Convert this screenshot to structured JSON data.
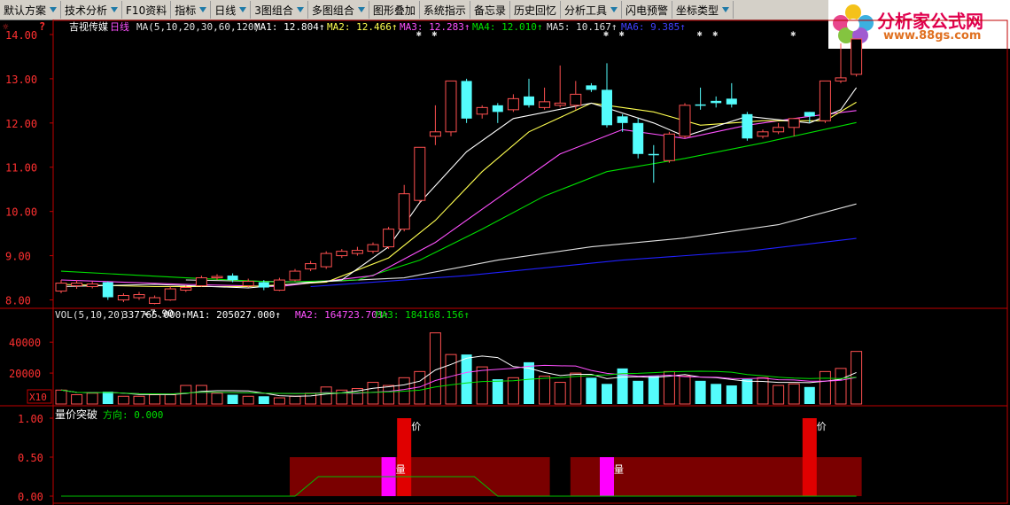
{
  "menu": [
    {
      "label": "默认方案",
      "dd": true
    },
    {
      "label": "技术分析",
      "dd": true
    },
    {
      "label": "F10资料",
      "dd": false
    },
    {
      "label": "指标",
      "dd": true
    },
    {
      "label": "日线",
      "dd": true
    },
    {
      "label": "3图组合",
      "dd": true
    },
    {
      "label": "多图组合",
      "dd": true
    },
    {
      "label": "图形叠加",
      "dd": false
    },
    {
      "label": "系统指示",
      "dd": false
    },
    {
      "label": "备忘录",
      "dd": false
    },
    {
      "label": "历史回忆",
      "dd": false
    },
    {
      "label": "分析工具",
      "dd": true
    },
    {
      "label": "闪电预警",
      "dd": false
    },
    {
      "label": "坐标类型",
      "dd": true
    }
  ],
  "logo": {
    "title": "分析家公式网",
    "url": "www.88gs.com"
  },
  "price_panel": {
    "stock_name": "吉视传媒",
    "period": "日线",
    "ma_param": "MA(5,10,20,30,60,120)",
    "ma1": "MA1: 12.804",
    "ma2": "MA2: 12.466",
    "ma3": "MA3: 12.283",
    "ma4": "MA4: 12.010",
    "ma5": "MA5: 10.167",
    "ma6": "MA6: 9.385",
    "low_label": "7.90",
    "y_ticks": [
      "14.00",
      "13.00",
      "12.00",
      "11.00",
      "10.00",
      "9.00",
      "8.00"
    ]
  },
  "vol_panel": {
    "param": "VOL(5,10,20)",
    "vol": "337765.000",
    "ma1": "MA1: 205027.000",
    "ma2": "MA2: 164723.703",
    "ma3": "MA3: 184168.156",
    "y_ticks": [
      "40000",
      "20000"
    ],
    "unit": "X10"
  },
  "ind_panel": {
    "name": "量价突破",
    "direction": "方向: 0.000",
    "y_ticks": [
      "1.00",
      "0.50",
      "0.00"
    ],
    "tag_price": "价",
    "tag_vol": "量"
  },
  "colors": {
    "up": "#ff5050",
    "down": "#54fcfc",
    "ma1": "#ffffff",
    "ma2": "#ffff50",
    "ma3": "#ff50ff",
    "ma4": "#00e000",
    "ma5": "#e0e0e0",
    "ma6": "#2020ff"
  },
  "chart_data": {
    "type": "candlestick",
    "price_range": [
      7.85,
      14.3
    ],
    "candles": [
      {
        "o": 8.2,
        "c": 8.38,
        "h": 8.45,
        "l": 8.15
      },
      {
        "o": 8.32,
        "c": 8.38,
        "h": 8.45,
        "l": 8.25
      },
      {
        "o": 8.3,
        "c": 8.36,
        "h": 8.42,
        "l": 8.26
      },
      {
        "o": 8.4,
        "c": 8.06,
        "h": 8.42,
        "l": 8.0
      },
      {
        "o": 8.0,
        "c": 8.1,
        "h": 8.15,
        "l": 7.95
      },
      {
        "o": 8.05,
        "c": 8.12,
        "h": 8.18,
        "l": 8.0
      },
      {
        "o": 7.92,
        "c": 8.05,
        "h": 8.1,
        "l": 7.9
      },
      {
        "o": 8.0,
        "c": 8.25,
        "h": 8.3,
        "l": 7.98
      },
      {
        "o": 8.22,
        "c": 8.28,
        "h": 8.33,
        "l": 8.18
      },
      {
        "o": 8.32,
        "c": 8.5,
        "h": 8.55,
        "l": 8.3
      },
      {
        "o": 8.5,
        "c": 8.53,
        "h": 8.58,
        "l": 8.45
      },
      {
        "o": 8.55,
        "c": 8.45,
        "h": 8.6,
        "l": 8.4
      },
      {
        "o": 8.32,
        "c": 8.42,
        "h": 8.48,
        "l": 8.28
      },
      {
        "o": 8.4,
        "c": 8.28,
        "h": 8.45,
        "l": 8.22
      },
      {
        "o": 8.22,
        "c": 8.45,
        "h": 8.5,
        "l": 8.2
      },
      {
        "o": 8.45,
        "c": 8.65,
        "h": 8.7,
        "l": 8.42
      },
      {
        "o": 8.7,
        "c": 8.82,
        "h": 8.88,
        "l": 8.65
      },
      {
        "o": 8.75,
        "c": 9.05,
        "h": 9.1,
        "l": 8.7
      },
      {
        "o": 9.0,
        "c": 9.1,
        "h": 9.15,
        "l": 8.95
      },
      {
        "o": 9.05,
        "c": 9.12,
        "h": 9.2,
        "l": 9.0
      },
      {
        "o": 9.1,
        "c": 9.25,
        "h": 9.3,
        "l": 9.05
      },
      {
        "o": 9.2,
        "c": 9.6,
        "h": 9.65,
        "l": 9.15
      },
      {
        "o": 9.6,
        "c": 10.4,
        "h": 10.6,
        "l": 9.55
      },
      {
        "o": 10.25,
        "c": 11.45,
        "h": 11.45,
        "l": 10.2
      },
      {
        "o": 11.7,
        "c": 11.8,
        "h": 12.4,
        "l": 11.5
      },
      {
        "o": 11.8,
        "c": 12.95,
        "h": 12.95,
        "l": 11.7
      },
      {
        "o": 12.95,
        "c": 12.1,
        "h": 13.0,
        "l": 12.0
      },
      {
        "o": 12.2,
        "c": 12.35,
        "h": 12.4,
        "l": 12.1
      },
      {
        "o": 12.4,
        "c": 12.25,
        "h": 12.45,
        "l": 12.0
      },
      {
        "o": 12.3,
        "c": 12.55,
        "h": 12.65,
        "l": 12.25
      },
      {
        "o": 12.6,
        "c": 12.4,
        "h": 13.0,
        "l": 12.35
      },
      {
        "o": 12.35,
        "c": 12.48,
        "h": 12.8,
        "l": 12.3
      },
      {
        "o": 12.4,
        "c": 12.45,
        "h": 13.3,
        "l": 12.35
      },
      {
        "o": 12.4,
        "c": 12.65,
        "h": 12.95,
        "l": 12.3
      },
      {
        "o": 12.85,
        "c": 12.75,
        "h": 12.9,
        "l": 12.7
      },
      {
        "o": 12.75,
        "c": 11.95,
        "h": 13.35,
        "l": 11.9
      },
      {
        "o": 12.15,
        "c": 12.0,
        "h": 12.2,
        "l": 11.8
      },
      {
        "o": 12.0,
        "c": 11.3,
        "h": 12.1,
        "l": 11.2
      },
      {
        "o": 11.3,
        "c": 11.28,
        "h": 11.5,
        "l": 10.65
      },
      {
        "o": 11.15,
        "c": 11.75,
        "h": 11.8,
        "l": 11.1
      },
      {
        "o": 11.7,
        "c": 12.4,
        "h": 12.45,
        "l": 11.65
      },
      {
        "o": 12.42,
        "c": 12.4,
        "h": 12.8,
        "l": 12.3
      },
      {
        "o": 12.5,
        "c": 12.45,
        "h": 12.6,
        "l": 12.35
      },
      {
        "o": 12.55,
        "c": 12.42,
        "h": 12.9,
        "l": 12.35
      },
      {
        "o": 12.2,
        "c": 11.65,
        "h": 12.25,
        "l": 11.6
      },
      {
        "o": 11.7,
        "c": 11.8,
        "h": 11.85,
        "l": 11.65
      },
      {
        "o": 11.8,
        "c": 11.9,
        "h": 12.0,
        "l": 11.75
      },
      {
        "o": 11.9,
        "c": 12.1,
        "h": 12.1,
        "l": 11.7
      },
      {
        "o": 12.25,
        "c": 12.15,
        "h": 12.25,
        "l": 12.0
      },
      {
        "o": 12.05,
        "c": 12.95,
        "h": 12.95,
        "l": 12.0
      },
      {
        "o": 12.95,
        "c": 13.02,
        "h": 13.8,
        "l": 12.9
      },
      {
        "o": 13.1,
        "c": 13.9,
        "h": 13.9,
        "l": 13.05
      }
    ],
    "ma_lines": {
      "ma1": [
        [
          8.3,
          0
        ],
        [
          8.35,
          6
        ],
        [
          8.27,
          12
        ],
        [
          8.45,
          18
        ],
        [
          9.2,
          21
        ],
        [
          10.2,
          23
        ],
        [
          11.35,
          26
        ],
        [
          12.1,
          29
        ],
        [
          12.45,
          34
        ],
        [
          12.0,
          38
        ],
        [
          11.7,
          40
        ],
        [
          12.15,
          44
        ],
        [
          12.0,
          48
        ],
        [
          12.3,
          50
        ],
        [
          12.8,
          51
        ]
      ],
      "ma2": [
        [
          8.35,
          0
        ],
        [
          8.3,
          6
        ],
        [
          8.3,
          12
        ],
        [
          8.4,
          17
        ],
        [
          8.95,
          21
        ],
        [
          9.8,
          24
        ],
        [
          10.9,
          27
        ],
        [
          11.8,
          30
        ],
        [
          12.45,
          34
        ],
        [
          12.25,
          38
        ],
        [
          11.95,
          41
        ],
        [
          12.05,
          45
        ],
        [
          12.05,
          49
        ],
        [
          12.47,
          51
        ]
      ],
      "ma3": [
        [
          8.45,
          0
        ],
        [
          8.35,
          8
        ],
        [
          8.3,
          14
        ],
        [
          8.55,
          20
        ],
        [
          9.3,
          24
        ],
        [
          10.3,
          28
        ],
        [
          11.3,
          32
        ],
        [
          11.85,
          36
        ],
        [
          11.65,
          40
        ],
        [
          11.95,
          44
        ],
        [
          12.15,
          48
        ],
        [
          12.28,
          51
        ]
      ],
      "ma4": [
        [
          8.65,
          0
        ],
        [
          8.5,
          8
        ],
        [
          8.4,
          14
        ],
        [
          8.45,
          19
        ],
        [
          8.9,
          23
        ],
        [
          9.6,
          27
        ],
        [
          10.35,
          31
        ],
        [
          10.9,
          35
        ],
        [
          11.2,
          40
        ],
        [
          11.55,
          45
        ],
        [
          12.01,
          51
        ]
      ],
      "ma5": [
        [
          8.45,
          8
        ],
        [
          8.4,
          16
        ],
        [
          8.5,
          22
        ],
        [
          8.9,
          28
        ],
        [
          9.2,
          34
        ],
        [
          9.4,
          40
        ],
        [
          9.7,
          46
        ],
        [
          10.17,
          51
        ]
      ],
      "ma6": [
        [
          8.3,
          16
        ],
        [
          8.55,
          26
        ],
        [
          8.9,
          36
        ],
        [
          9.1,
          44
        ],
        [
          9.39,
          51
        ]
      ]
    },
    "volume": [
      9,
      6,
      7,
      8,
      5,
      5,
      6,
      6,
      12,
      12,
      7,
      6,
      5,
      5,
      4,
      5,
      7,
      11,
      9,
      10,
      14,
      12,
      17,
      21,
      46,
      32,
      32,
      24,
      16,
      17,
      27,
      18,
      14,
      20,
      17,
      13,
      23,
      15,
      18,
      21,
      18,
      15,
      13,
      12,
      16,
      17,
      12,
      13,
      11,
      21,
      23,
      34
    ],
    "volume_range": [
      0,
      55000
    ],
    "indicator": {
      "price_breakout_bars": [
        22,
        48
      ],
      "volume_breakout_bars": [
        21,
        35
      ],
      "zones": [
        [
          15,
          31
        ],
        [
          33,
          51
        ]
      ],
      "direction": [
        [
          0,
          0
        ],
        [
          15,
          0
        ],
        [
          16.5,
          0.25
        ],
        [
          26.5,
          0.25
        ],
        [
          28,
          0
        ],
        [
          51,
          0
        ]
      ]
    }
  }
}
